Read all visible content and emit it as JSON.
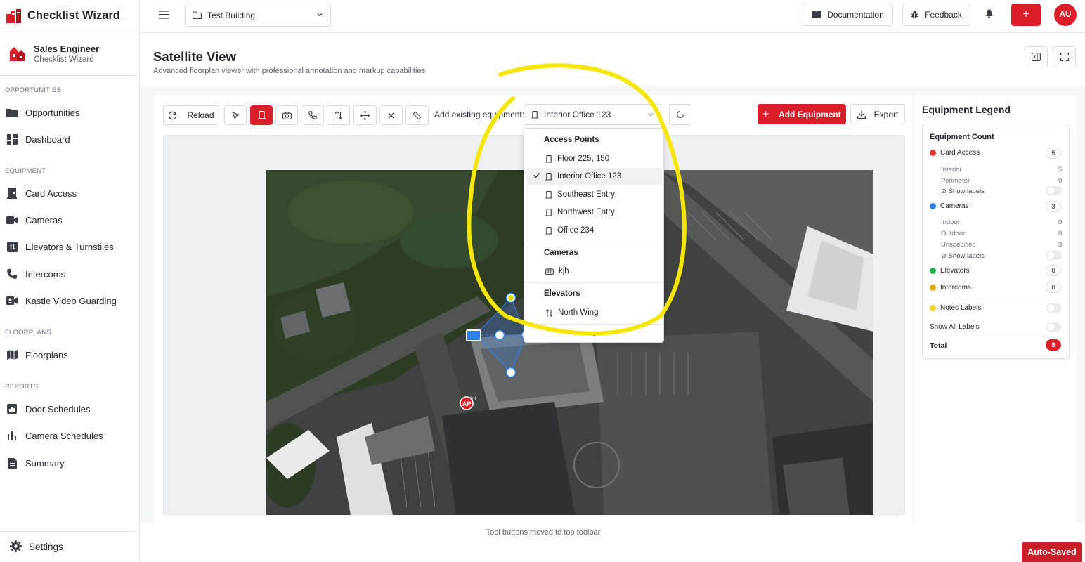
{
  "app": {
    "title": "Checklist Wizard"
  },
  "user": {
    "role": "Sales Engineer",
    "app": "Checklist Wizard"
  },
  "sidebar": {
    "sections": [
      {
        "label": "OPPORTUNITIES"
      },
      {
        "label": "EQUIPMENT"
      },
      {
        "label": "FLOORPLANS"
      },
      {
        "label": "REPORTS"
      }
    ],
    "items": [
      {
        "label": "Opportunities",
        "icon": "folder-icon"
      },
      {
        "label": "Dashboard",
        "icon": "dashboard-icon"
      },
      {
        "label": "Card Access",
        "icon": "door-icon"
      },
      {
        "label": "Cameras",
        "icon": "video-icon"
      },
      {
        "label": "Elevators & Turnstiles",
        "icon": "elevator-icon"
      },
      {
        "label": "Intercoms",
        "icon": "phone-icon"
      },
      {
        "label": "Kastle Video Guarding",
        "icon": "video-guard-icon"
      },
      {
        "label": "Floorplans",
        "icon": "map-icon"
      },
      {
        "label": "Door Schedules",
        "icon": "report-icon"
      },
      {
        "label": "Camera Schedules",
        "icon": "bar-chart-icon"
      },
      {
        "label": "Summary",
        "icon": "summary-icon"
      }
    ],
    "settings_label": "Settings"
  },
  "topbar": {
    "building": "Test Building",
    "documentation_label": "Documentation",
    "feedback_label": "Feedback",
    "plus_label": "+",
    "avatar_initials": "AU"
  },
  "page": {
    "title": "Satellite View",
    "subtitle": "Advanced floorplan viewer with professional annotation and markup capabilities"
  },
  "toolbar": {
    "reload_label": "Reload",
    "add_existing_label": "Add existing equipment:",
    "selected_equipment": "Interior Office 123",
    "add_equipment_label": "Add Equipment",
    "export_label": "Export"
  },
  "dropdown": {
    "groups": [
      {
        "header": "Access Points",
        "items": [
          "Floor 225, 150",
          "Interior Office 123",
          "Southeast Entry",
          "Northwest Entry",
          "Office 234"
        ]
      },
      {
        "header": "Cameras",
        "items": [
          "kjh"
        ]
      },
      {
        "header": "Elevators",
        "items": [
          "North Wing"
        ]
      }
    ],
    "selected": "Interior Office 123"
  },
  "legend": {
    "title": "Equipment Legend",
    "count_title": "Equipment Count",
    "card_access": {
      "label": "Card Access",
      "count": "5",
      "color": "#e53935",
      "sub": [
        {
          "label": "Interior",
          "value": "5"
        },
        {
          "label": "Perimeter",
          "value": "0"
        }
      ],
      "show_labels": "Show labels"
    },
    "cameras": {
      "label": "Cameras",
      "count": "3",
      "color": "#2f80ed",
      "sub": [
        {
          "label": "Indoor",
          "value": "0"
        },
        {
          "label": "Outdoor",
          "value": "0"
        },
        {
          "label": "Unspecified",
          "value": "3"
        }
      ],
      "show_labels": "Show labels"
    },
    "elevators": {
      "label": "Elevators",
      "count": "0",
      "color": "#22b14c"
    },
    "intercoms": {
      "label": "Intercoms",
      "count": "0",
      "color": "#e0a800"
    },
    "notes_labels": {
      "label": "Notes Labels",
      "color": "#f2d230"
    },
    "show_all_labels": "Show All Labels",
    "total_label": "Total",
    "total_count": "8"
  },
  "map": {
    "marker_ap_label": "AP",
    "marker_ap_tag": "Int"
  },
  "footer_note": "Tool buttons moved to top toolbar",
  "autosaved_label": "Auto-Saved",
  "colors": {
    "brand_red": "#d91f2a",
    "highlight_yellow": "#f5e600",
    "camera_blue": "#2f80ed"
  }
}
